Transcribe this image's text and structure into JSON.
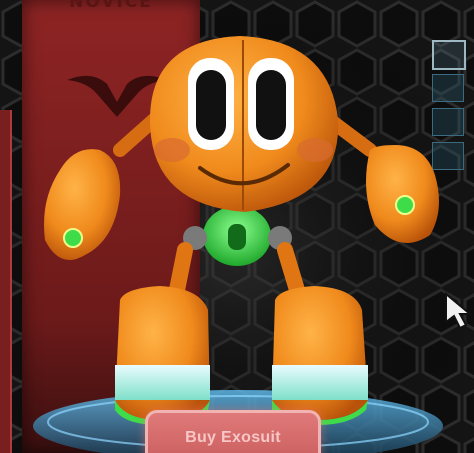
{
  "rank_banner": {
    "label": "NOVICE"
  },
  "actions": {
    "buy_label": "Buy Exosuit"
  },
  "side_slots": {
    "icons": [
      "slot-active",
      "slot",
      "slot",
      "slot"
    ]
  },
  "colors": {
    "background": "#141414",
    "hex_grid": "#2c2c2c",
    "banner": "#8e2424",
    "robot_body": "#f08a1c",
    "robot_accent": "#3fdc4a",
    "robot_boots": "#bff1f0",
    "buy_button": "#d96a6a",
    "platform_glow": "#3a8fd0"
  }
}
